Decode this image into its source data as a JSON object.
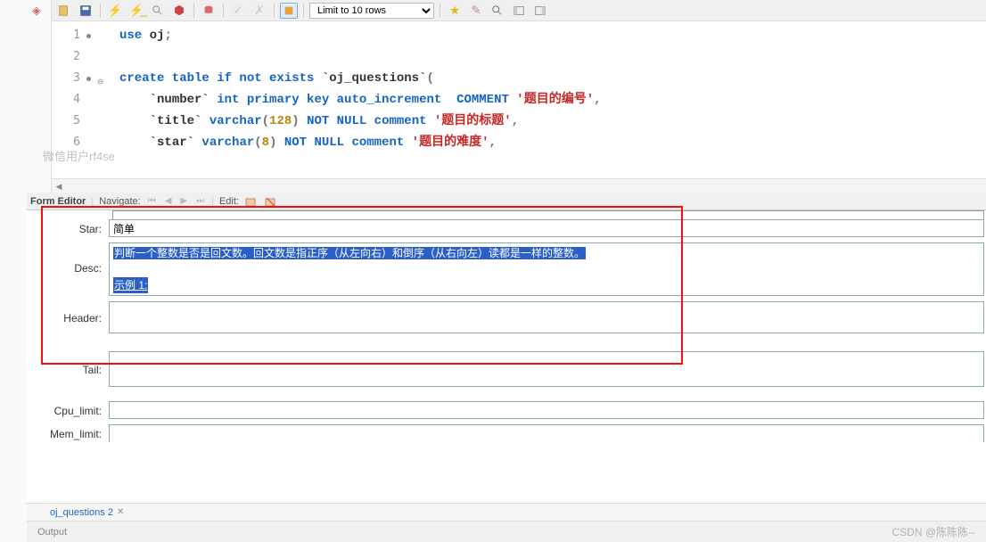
{
  "toolbar": {
    "limit_dropdown": "Limit to 10 rows",
    "icons": [
      "new-file",
      "save",
      "lightning",
      "run-script",
      "search",
      "stop",
      "db-tree",
      "commit",
      "rollback",
      "highlight",
      "favorite",
      "wand",
      "zoom",
      "panel-left",
      "panel-right"
    ]
  },
  "editor": {
    "lines": [
      {
        "n": 1,
        "dot": true
      },
      {
        "n": 2,
        "dot": false
      },
      {
        "n": 3,
        "dot": true,
        "fold": true
      },
      {
        "n": 4,
        "dot": false
      },
      {
        "n": 5,
        "dot": false
      },
      {
        "n": 6,
        "dot": false
      }
    ],
    "code": {
      "l1_kw1": "use",
      "l1_id": " oj",
      "l1_p": ";",
      "l3_kw": "create table if not exists",
      "l3_bt": " `oj_questions`",
      "l3_p": "(",
      "l4_col": "`number`",
      "l4_type": " int primary key auto_increment  ",
      "l4_cmt_kw": "COMMENT ",
      "l4_str": "'题目的编号'",
      "l4_p": ",",
      "l5_col": "`title`",
      "l5_type": " varchar",
      "l5_paren": "(",
      "l5_num": "128",
      "l5_paren2": ")",
      "l5_null": " NOT NULL comment ",
      "l5_str": "'题目的标题'",
      "l5_p": ",",
      "l6_col": "`star`",
      "l6_type": " varchar",
      "l6_paren": "(",
      "l6_num": "8",
      "l6_paren2": ")",
      "l6_null": " NOT NULL comment ",
      "l6_str": "'题目的难度'",
      "l6_p": ","
    }
  },
  "watermark_user": "微信用户rf4se",
  "form_tabs": {
    "form_editor": "Form Editor",
    "navigate": "Navigate:",
    "edit": "Edit:"
  },
  "form": {
    "star_label": "Star:",
    "star_value": "简单",
    "desc_label": "Desc:",
    "desc_line1": "判断一个整数是否是回文数。回文数是指正序（从左向右）和倒序（从右向左）读都是一样的整数。",
    "desc_line2": "示例 1:",
    "header_label": "Header:",
    "header_value": "",
    "tail_label": "Tail:",
    "tail_value": "",
    "cpu_label": "Cpu_limit:",
    "cpu_value": "",
    "mem_label": "Mem_limit:",
    "mem_value": ""
  },
  "result_tab": "oj_questions 2",
  "statusbar": {
    "left": "Output",
    "csdn": "CSDN @陈陈陈--"
  }
}
